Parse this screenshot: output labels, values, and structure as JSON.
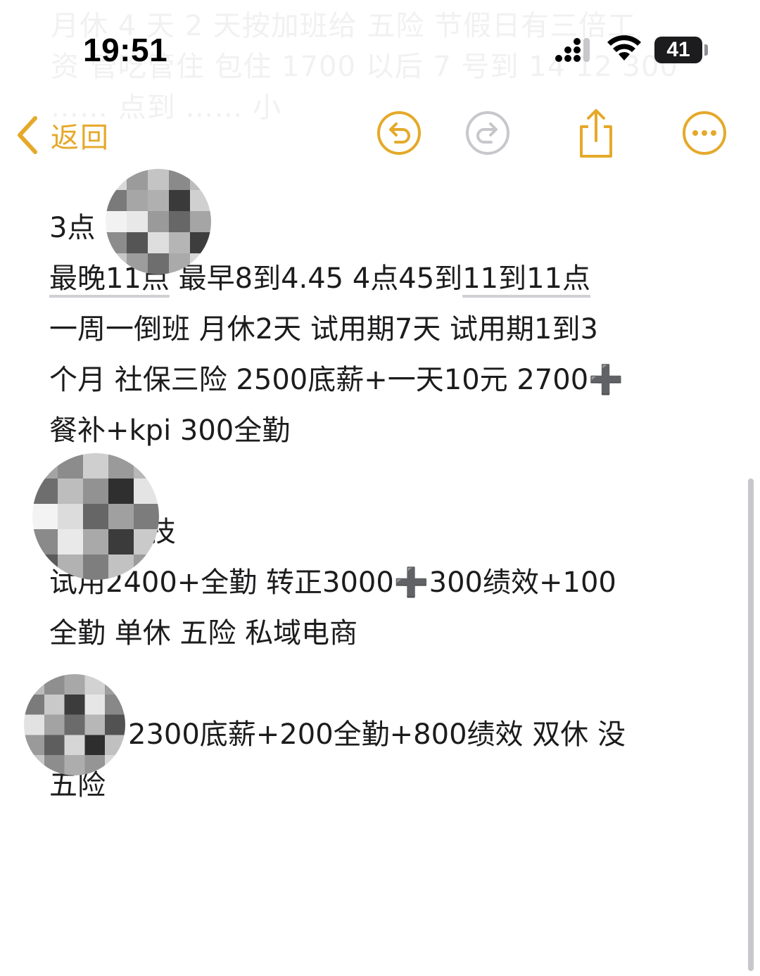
{
  "status_bar": {
    "time": "19:51",
    "battery_level": "41"
  },
  "nav": {
    "back_label": "返回",
    "accent_color": "#e5a92a",
    "icons": [
      "undo-icon",
      "redo-icon",
      "share-icon",
      "more-icon"
    ]
  },
  "ghost_text": [
    "月休 4 天 2 天按加班给 五险 节假日有三倍工",
    "资 管吃管住 包住 1700 以后 7 号到 14 12 300",
    "…… 点到 …… 小"
  ],
  "note": {
    "p1_line1": "3点",
    "p1_line2_a": "最晚11点",
    "p1_line2_b": " 最早8到4.45 4点45到",
    "p1_line2_c": "11到11点",
    "p1_line3": "一周一倒班 月休2天 试用期7天 试用期1到3",
    "p1_line4": "个月 社保三险 2500底薪+一天10元 2700➕",
    "p1_line5": "餐补+kpi 300全勤",
    "p2_line1": "技",
    "p2_line2": "试用2400+全勤 转正3000➕300绩效+100",
    "p2_line3": "全勤 单休 五险 私域电商",
    "p3_line1": "2300底薪+200全勤+800绩效 双休 没",
    "p3_line2": "五险"
  }
}
